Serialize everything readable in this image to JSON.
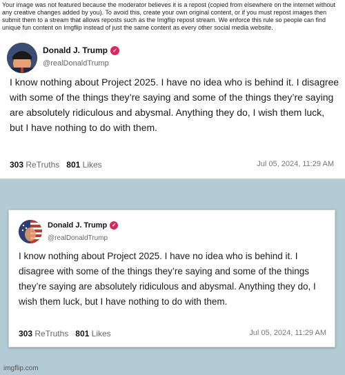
{
  "notice": {
    "text": "Your image was not featured because the moderator believes it is a repost (copied from elsewhere on the internet without any creative changes added by you). To avoid this, create your own original content, or if you must repost images then submit them to a stream that allows reposts such as the Imgflip repost stream. We enforce this rule so people can find unique fun content on Imgflip instead of just the same content as every other social media website."
  },
  "post1": {
    "name": "Donald J. Trump",
    "handle": "@realDonaldTrump",
    "body": "I know nothing about Project 2025. I have no idea who is behind it. I disagree with some of the things they’re saying and some of the things they’re saying are absolutely ridiculous and abysmal. Anything they do, I wish them luck, but I have nothing to do with them.",
    "retruths_count": "303",
    "retruths_label": "ReTruths",
    "likes_count": "801",
    "likes_label": "Likes",
    "date": "Jul 05, 2024, 11:29 AM"
  },
  "post2": {
    "name": "Donald J. Trump",
    "handle": "@realDonaldTrump",
    "body": "I know nothing about Project 2025. I have no idea who is behind it. I disagree with some of the things they’re saying and some of the things they’re saying are absolutely ridiculous and abysmal. Anything they do, I wish them luck, but I have nothing to do with them.",
    "retruths_count": "303",
    "retruths_label": "ReTruths",
    "likes_count": "801",
    "likes_label": "Likes",
    "date": "Jul 05, 2024, 11:29 AM"
  },
  "icons": {
    "verified": "verified-check-icon",
    "avatar": "avatar-image"
  },
  "colors": {
    "verified": "#e0245e",
    "background": "#b3cbd3"
  },
  "watermark": "imgflip.com"
}
